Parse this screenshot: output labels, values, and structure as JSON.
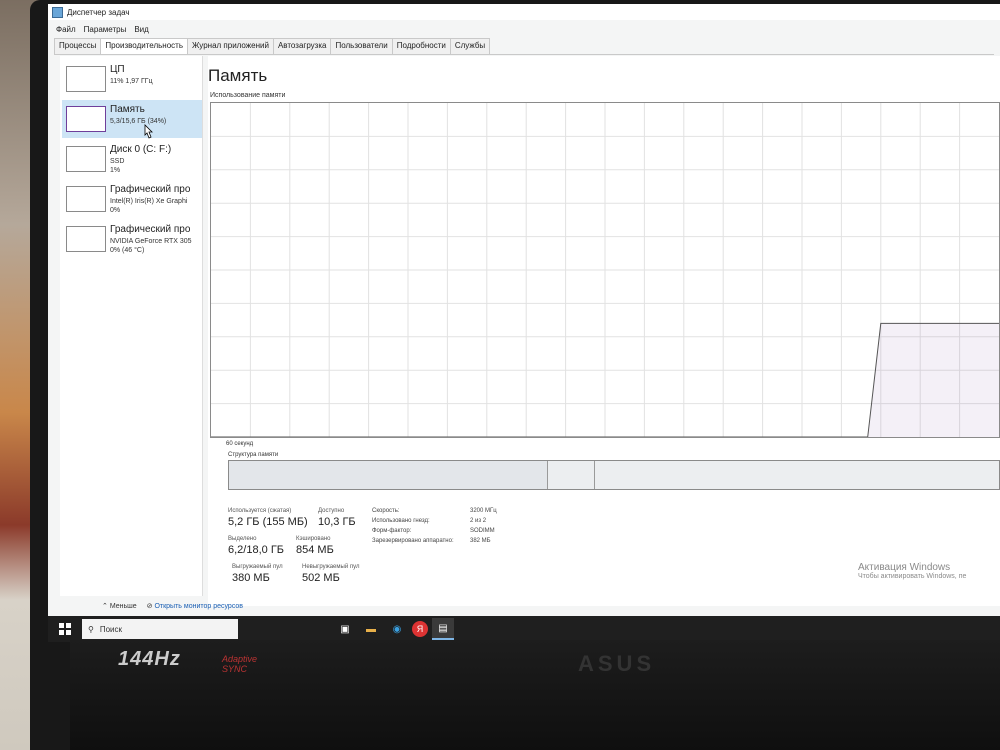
{
  "window": {
    "title": "Диспетчер задач"
  },
  "menu": [
    "Файл",
    "Параметры",
    "Вид"
  ],
  "tabs": [
    "Процессы",
    "Производительность",
    "Журнал приложений",
    "Автозагрузка",
    "Пользователи",
    "Подробности",
    "Службы"
  ],
  "active_tab_index": 1,
  "sidebar": [
    {
      "name": "ЦП",
      "line1": "11% 1,97 ГГц",
      "line2": ""
    },
    {
      "name": "Память",
      "line1": "5,3/15,6 ГБ (34%)",
      "line2": ""
    },
    {
      "name": "Диск 0 (C: F:)",
      "line1": "SSD",
      "line2": "1%"
    },
    {
      "name": "Графический про",
      "line1": "Intel(R) Iris(R) Xe Graphi",
      "line2": "0%"
    },
    {
      "name": "Графический про",
      "line1": "NVIDIA GeForce RTX 305",
      "line2": "0% (46 °C)"
    }
  ],
  "main": {
    "title": "Память",
    "chart_label": "Использование памяти",
    "chart_axis": "60 секунд",
    "structure_label": "Структура памяти"
  },
  "stats": {
    "used_label": "Используется (сжатая)",
    "used": "5,2 ГБ (155 МБ)",
    "avail_label": "Доступно",
    "avail": "10,3 ГБ",
    "commit_label": "Выделено",
    "commit": "6,2/18,0 ГБ",
    "cached_label": "Кэшировано",
    "cached": "854 МБ",
    "paged_label": "Выгружаемый пул",
    "paged": "380 МБ",
    "nonpaged_label": "Невыгружаемый пул",
    "nonpaged": "502 МБ"
  },
  "specs": [
    {
      "label": "Скорость:",
      "value": "3200 МГц"
    },
    {
      "label": "Использовано гнезд:",
      "value": "2 из 2"
    },
    {
      "label": "Форм-фактор:",
      "value": "SODIMM"
    },
    {
      "label": "Зарезервировано аппаратно:",
      "value": "382 МБ"
    }
  ],
  "footer": {
    "less": "Меньше",
    "monitor": "Открыть монитор ресурсов"
  },
  "activation": {
    "title": "Активация Windows",
    "text": "Чтобы активировать Windows, пе"
  },
  "taskbar": {
    "search_placeholder": "Поиск"
  },
  "device": {
    "brand_left": "144Hz",
    "brand_right_1": "Adaptive",
    "brand_right_2": "SYNC",
    "logo": "ASUS"
  },
  "colors": {
    "memory_accent": "#6f3f9a",
    "selection": "#cde4f5",
    "taskbar": "#1f1f1f"
  },
  "chart_data": {
    "type": "area",
    "title": "Использование памяти",
    "x_label": "60 секунд",
    "y_unit": "%",
    "ylim": [
      0,
      100
    ],
    "series": [
      {
        "values": [
          0,
          0,
          0,
          0,
          0,
          0,
          0,
          0,
          0,
          0,
          0,
          0,
          0,
          0,
          0,
          0,
          0,
          0,
          0,
          0,
          0,
          0,
          0,
          0,
          0,
          0,
          0,
          0,
          0,
          0,
          0,
          0,
          0,
          0,
          0,
          0,
          0,
          0,
          0,
          0,
          0,
          0,
          0,
          0,
          0,
          0,
          0,
          0,
          0,
          0,
          0,
          34,
          34,
          34,
          34,
          34,
          34,
          34,
          34,
          34,
          34
        ]
      }
    ]
  }
}
